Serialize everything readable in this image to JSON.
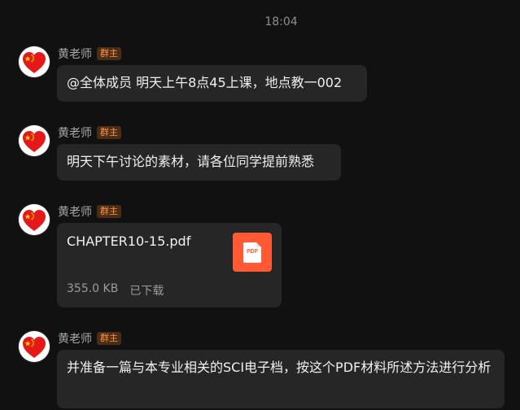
{
  "time": "18:04",
  "sender": {
    "name": "黄老师",
    "role_badge": "群主"
  },
  "messages": [
    {
      "text": "@全体成员 明天上午8点45上课，地点教一002"
    },
    {
      "text": "明天下午讨论的素材，请各位同学提前熟悉"
    },
    {
      "file_name": "CHAPTER10-15.pdf",
      "file_type": "PDF",
      "size": "355.0 KB",
      "status": "已下载"
    },
    {
      "text": "并准备一篇与本专业相关的SCI电子档，按这个PDF材料所述方法进行分析"
    }
  ],
  "colors": {
    "background": "#111111",
    "bubble": "#262626",
    "badge_bg": "#4a2d16",
    "badge_text": "#ff9340",
    "pdf_icon": "#ff5a33"
  }
}
